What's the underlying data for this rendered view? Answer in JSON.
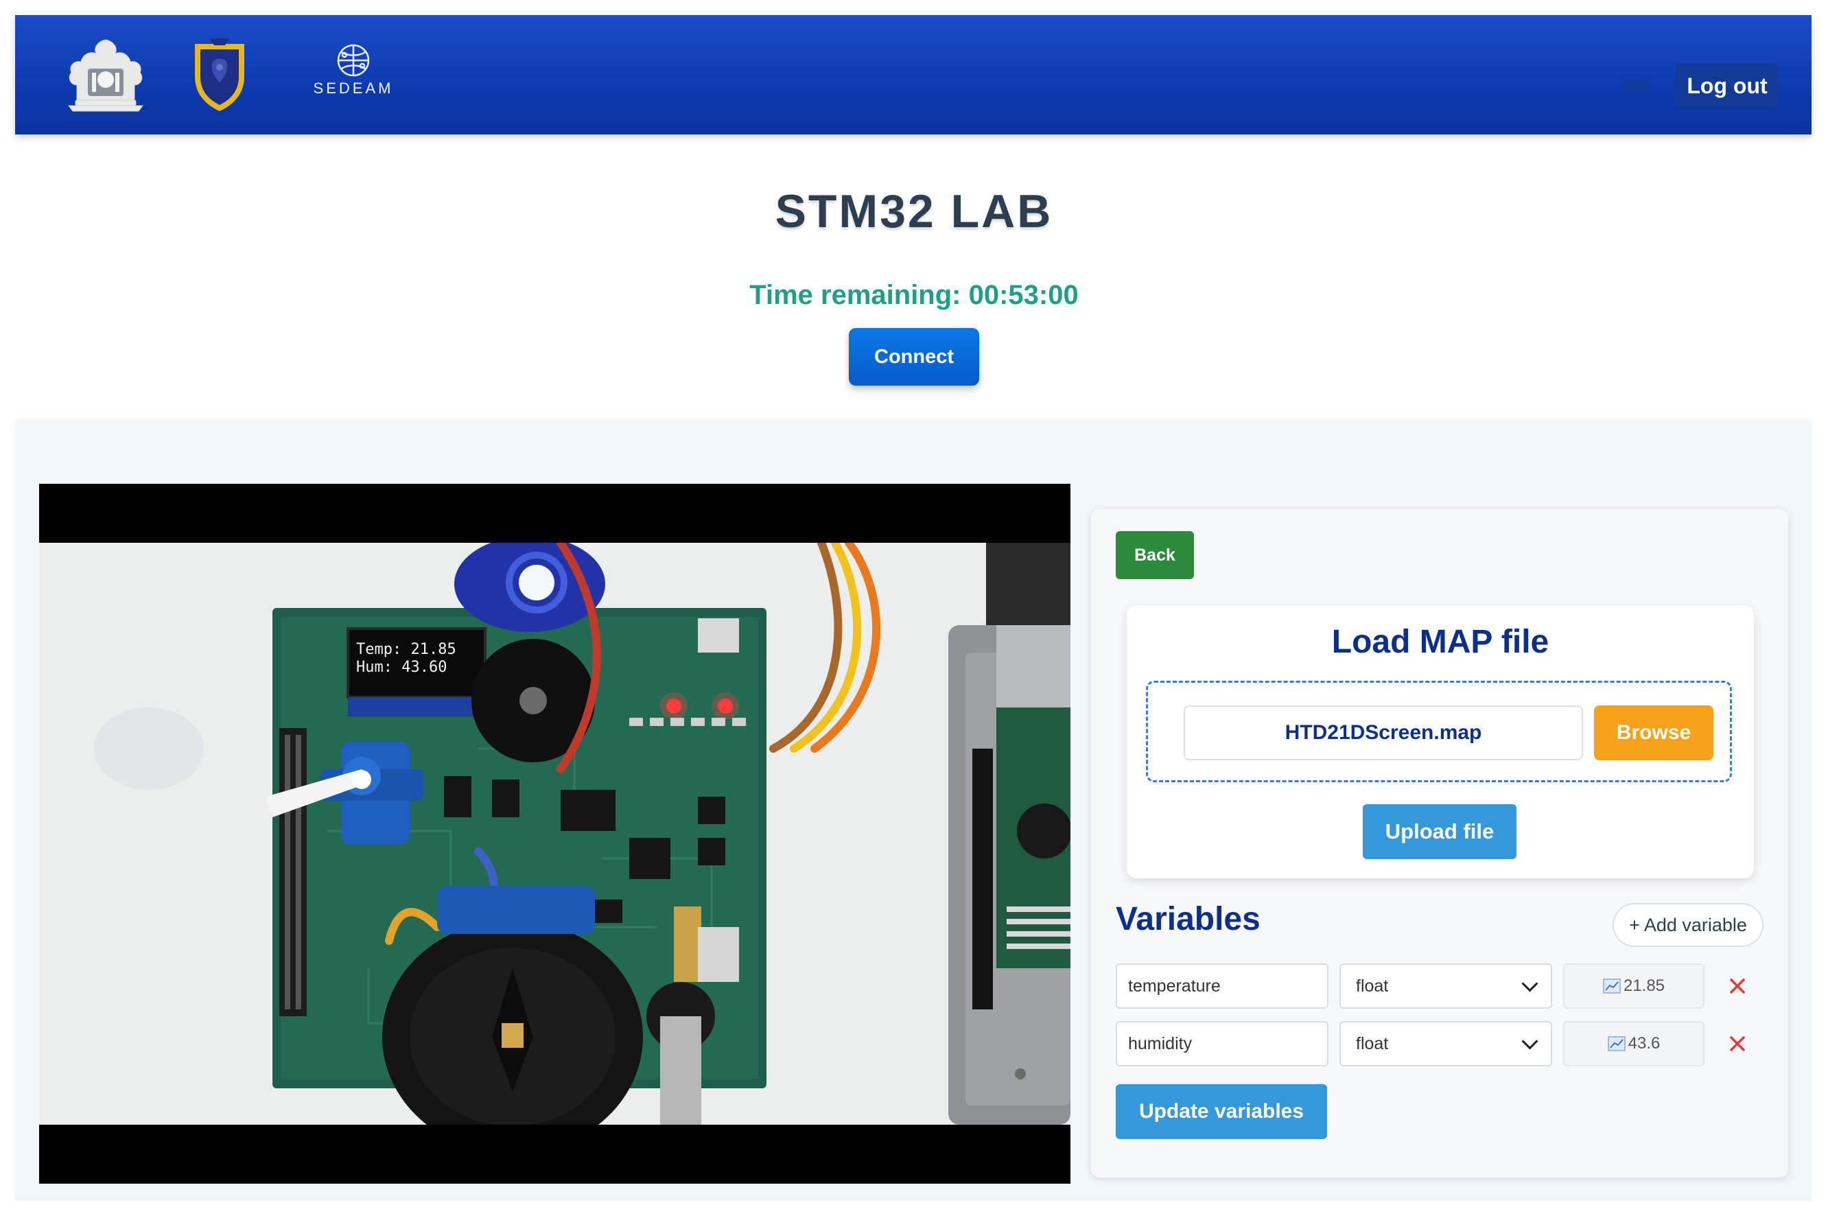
{
  "header": {
    "logo_text": "SEDEAM",
    "logout_label": "Log out"
  },
  "main": {
    "title": "STM32 LAB",
    "time_remaining": "Time remaining: 00:53:00",
    "connect_label": "Connect"
  },
  "video": {
    "oled_line1": "Temp: 21.85",
    "oled_line2": "Hum: 43.60"
  },
  "side": {
    "back_label": "Back",
    "load_title": "Load MAP file",
    "file_name": "HTD21DScreen.map",
    "browse_label": "Browse",
    "upload_label": "Upload file",
    "variables_title": "Variables",
    "add_variable_label": "+ Add variable",
    "variables": [
      {
        "name": "temperature",
        "type": "float",
        "value": "21.85"
      },
      {
        "name": "humidity",
        "type": "float",
        "value": "43.6"
      }
    ],
    "update_label": "Update variables"
  },
  "colors": {
    "header_blue": "#0d3aaf",
    "accent_green": "#1fa086",
    "title_navy": "#0d2f8c",
    "browse_orange": "#f5a21b",
    "button_blue": "#3498db",
    "back_green": "#2c8a3a",
    "delete_red": "#e53935"
  },
  "icons": {
    "chart": "chart-line-icon",
    "delete": "close-icon"
  }
}
